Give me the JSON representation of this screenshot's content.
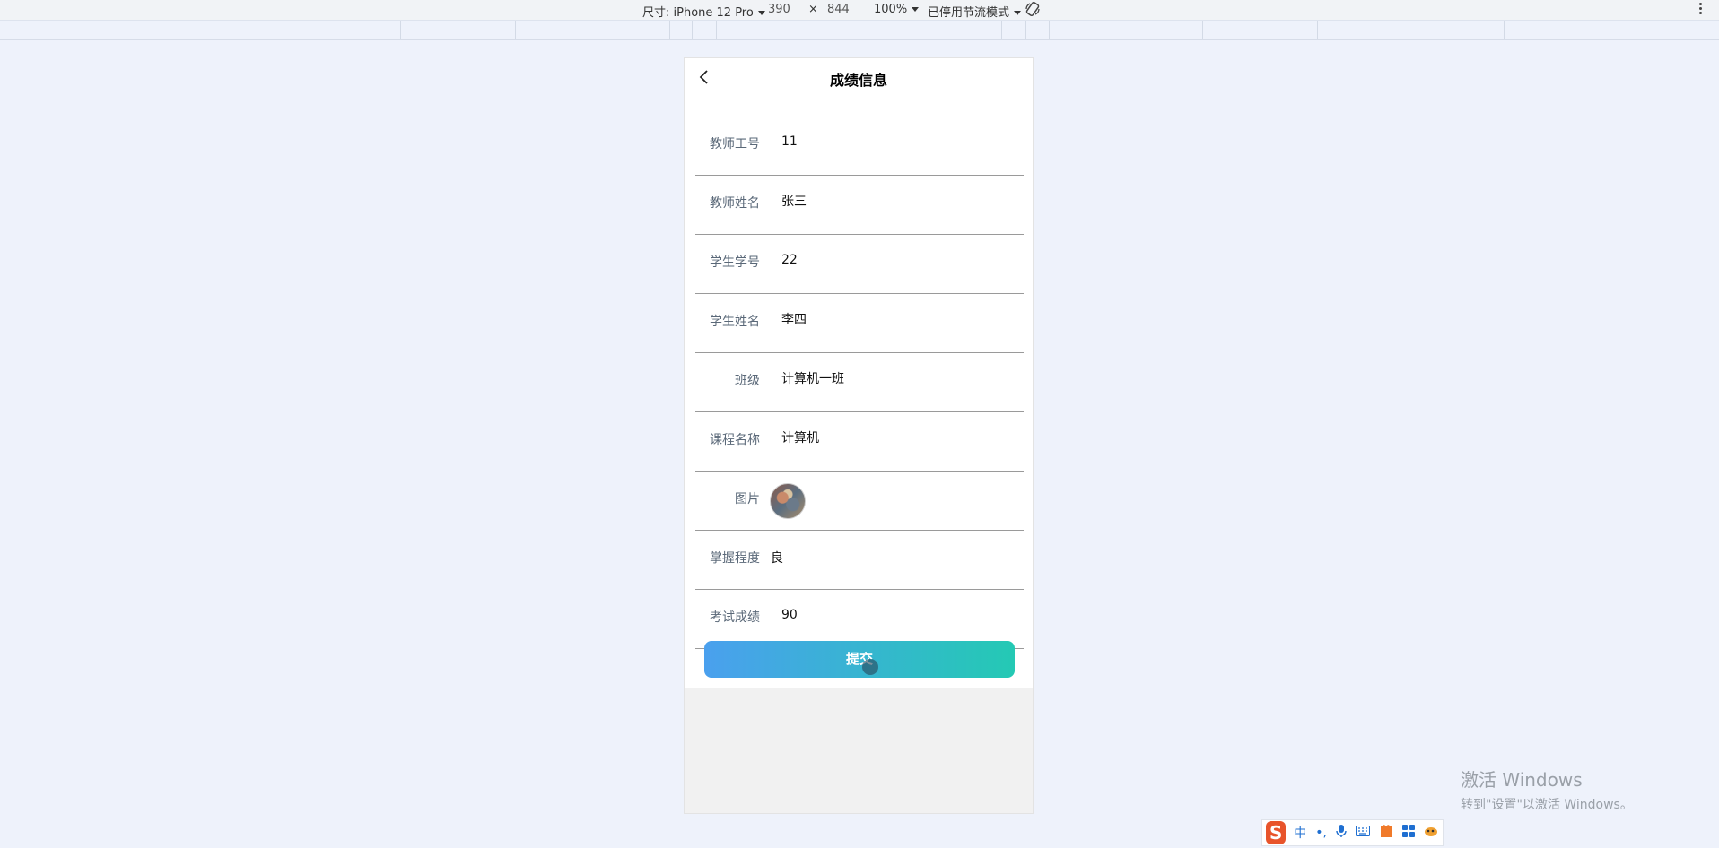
{
  "devtools": {
    "size_label": "尺寸: iPhone 12 Pro",
    "width": "390",
    "times": "×",
    "height": "844",
    "zoom": "100%",
    "throttle": "已停用节流模式"
  },
  "page": {
    "title": "成绩信息",
    "fields": [
      {
        "label": "教师工号",
        "value": "11"
      },
      {
        "label": "教师姓名",
        "value": "张三"
      },
      {
        "label": "学生学号",
        "value": "22"
      },
      {
        "label": "学生姓名",
        "value": "李四"
      },
      {
        "label": "班级",
        "value": "计算机一班"
      },
      {
        "label": "课程名称",
        "value": "计算机"
      },
      {
        "label": "图片",
        "value": ""
      },
      {
        "label": "掌握程度",
        "value": "良"
      },
      {
        "label": "考试成绩",
        "value": "90"
      }
    ],
    "submit_label": "提交"
  },
  "watermark": {
    "line1": "激活 Windows",
    "line2": "转到\"设置\"以激活 Windows。"
  },
  "ime": {
    "logo": "S",
    "lang": "中",
    "punct": "•,"
  }
}
